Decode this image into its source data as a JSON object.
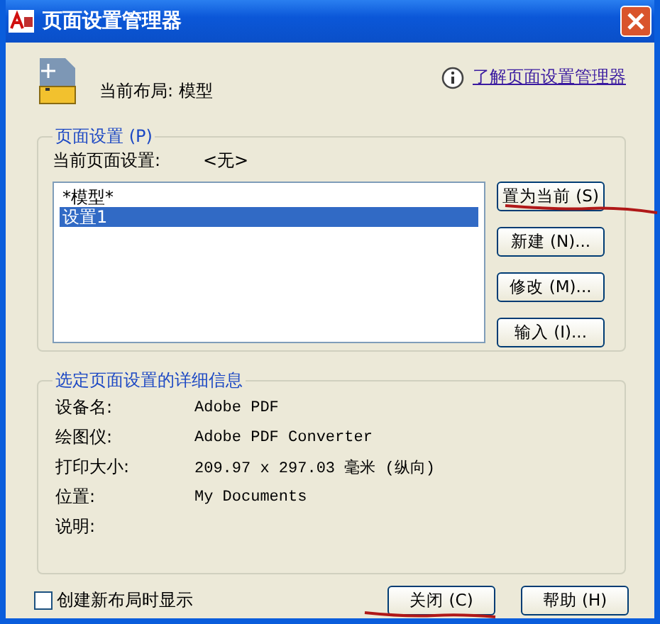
{
  "window": {
    "title": "页面设置管理器"
  },
  "current_layout": {
    "label": "当前布局:",
    "value": "模型"
  },
  "help_link": "了解页面设置管理器",
  "page_setups": {
    "title": "页面设置 (P)",
    "current_label": "当前页面设置:",
    "current_value": "<无>",
    "items": [
      {
        "label": "*模型*",
        "selected": false
      },
      {
        "label": "设置1",
        "selected": true
      }
    ],
    "buttons": [
      "置为当前 (S)",
      "新建 (N)...",
      "修改 (M)...",
      "输入 (I)..."
    ]
  },
  "details": {
    "title": "选定页面设置的详细信息",
    "rows": [
      {
        "label": "设备名:",
        "value": "Adobe PDF"
      },
      {
        "label": "绘图仪:",
        "value": "Adobe PDF Converter"
      },
      {
        "label": "打印大小:",
        "value": "209.97 x 297.03 毫米 (纵向)"
      },
      {
        "label": "位置:",
        "value": "My Documents"
      },
      {
        "label": "说明:"
      }
    ]
  },
  "show_on_new_layout": {
    "label": "创建新布局时显示",
    "checked": false
  },
  "footer_buttons": [
    "关闭 (C)",
    "帮助 (H)"
  ]
}
